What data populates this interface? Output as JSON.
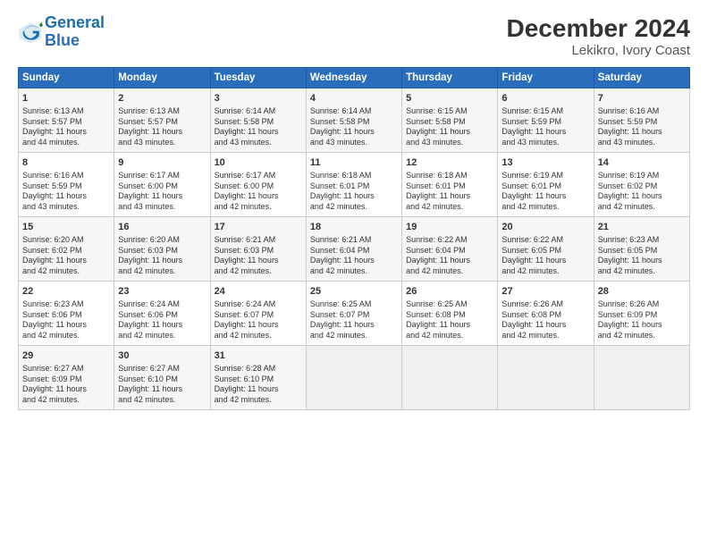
{
  "logo": {
    "line1": "General",
    "line2": "Blue"
  },
  "title": "December 2024",
  "subtitle": "Lekikro, Ivory Coast",
  "days_of_week": [
    "Sunday",
    "Monday",
    "Tuesday",
    "Wednesday",
    "Thursday",
    "Friday",
    "Saturday"
  ],
  "weeks": [
    [
      {
        "day": "1",
        "info": "Sunrise: 6:13 AM\nSunset: 5:57 PM\nDaylight: 11 hours\nand 44 minutes."
      },
      {
        "day": "2",
        "info": "Sunrise: 6:13 AM\nSunset: 5:57 PM\nDaylight: 11 hours\nand 43 minutes."
      },
      {
        "day": "3",
        "info": "Sunrise: 6:14 AM\nSunset: 5:58 PM\nDaylight: 11 hours\nand 43 minutes."
      },
      {
        "day": "4",
        "info": "Sunrise: 6:14 AM\nSunset: 5:58 PM\nDaylight: 11 hours\nand 43 minutes."
      },
      {
        "day": "5",
        "info": "Sunrise: 6:15 AM\nSunset: 5:58 PM\nDaylight: 11 hours\nand 43 minutes."
      },
      {
        "day": "6",
        "info": "Sunrise: 6:15 AM\nSunset: 5:59 PM\nDaylight: 11 hours\nand 43 minutes."
      },
      {
        "day": "7",
        "info": "Sunrise: 6:16 AM\nSunset: 5:59 PM\nDaylight: 11 hours\nand 43 minutes."
      }
    ],
    [
      {
        "day": "8",
        "info": "Sunrise: 6:16 AM\nSunset: 5:59 PM\nDaylight: 11 hours\nand 43 minutes."
      },
      {
        "day": "9",
        "info": "Sunrise: 6:17 AM\nSunset: 6:00 PM\nDaylight: 11 hours\nand 43 minutes."
      },
      {
        "day": "10",
        "info": "Sunrise: 6:17 AM\nSunset: 6:00 PM\nDaylight: 11 hours\nand 42 minutes."
      },
      {
        "day": "11",
        "info": "Sunrise: 6:18 AM\nSunset: 6:01 PM\nDaylight: 11 hours\nand 42 minutes."
      },
      {
        "day": "12",
        "info": "Sunrise: 6:18 AM\nSunset: 6:01 PM\nDaylight: 11 hours\nand 42 minutes."
      },
      {
        "day": "13",
        "info": "Sunrise: 6:19 AM\nSunset: 6:01 PM\nDaylight: 11 hours\nand 42 minutes."
      },
      {
        "day": "14",
        "info": "Sunrise: 6:19 AM\nSunset: 6:02 PM\nDaylight: 11 hours\nand 42 minutes."
      }
    ],
    [
      {
        "day": "15",
        "info": "Sunrise: 6:20 AM\nSunset: 6:02 PM\nDaylight: 11 hours\nand 42 minutes."
      },
      {
        "day": "16",
        "info": "Sunrise: 6:20 AM\nSunset: 6:03 PM\nDaylight: 11 hours\nand 42 minutes."
      },
      {
        "day": "17",
        "info": "Sunrise: 6:21 AM\nSunset: 6:03 PM\nDaylight: 11 hours\nand 42 minutes."
      },
      {
        "day": "18",
        "info": "Sunrise: 6:21 AM\nSunset: 6:04 PM\nDaylight: 11 hours\nand 42 minutes."
      },
      {
        "day": "19",
        "info": "Sunrise: 6:22 AM\nSunset: 6:04 PM\nDaylight: 11 hours\nand 42 minutes."
      },
      {
        "day": "20",
        "info": "Sunrise: 6:22 AM\nSunset: 6:05 PM\nDaylight: 11 hours\nand 42 minutes."
      },
      {
        "day": "21",
        "info": "Sunrise: 6:23 AM\nSunset: 6:05 PM\nDaylight: 11 hours\nand 42 minutes."
      }
    ],
    [
      {
        "day": "22",
        "info": "Sunrise: 6:23 AM\nSunset: 6:06 PM\nDaylight: 11 hours\nand 42 minutes."
      },
      {
        "day": "23",
        "info": "Sunrise: 6:24 AM\nSunset: 6:06 PM\nDaylight: 11 hours\nand 42 minutes."
      },
      {
        "day": "24",
        "info": "Sunrise: 6:24 AM\nSunset: 6:07 PM\nDaylight: 11 hours\nand 42 minutes."
      },
      {
        "day": "25",
        "info": "Sunrise: 6:25 AM\nSunset: 6:07 PM\nDaylight: 11 hours\nand 42 minutes."
      },
      {
        "day": "26",
        "info": "Sunrise: 6:25 AM\nSunset: 6:08 PM\nDaylight: 11 hours\nand 42 minutes."
      },
      {
        "day": "27",
        "info": "Sunrise: 6:26 AM\nSunset: 6:08 PM\nDaylight: 11 hours\nand 42 minutes."
      },
      {
        "day": "28",
        "info": "Sunrise: 6:26 AM\nSunset: 6:09 PM\nDaylight: 11 hours\nand 42 minutes."
      }
    ],
    [
      {
        "day": "29",
        "info": "Sunrise: 6:27 AM\nSunset: 6:09 PM\nDaylight: 11 hours\nand 42 minutes."
      },
      {
        "day": "30",
        "info": "Sunrise: 6:27 AM\nSunset: 6:10 PM\nDaylight: 11 hours\nand 42 minutes."
      },
      {
        "day": "31",
        "info": "Sunrise: 6:28 AM\nSunset: 6:10 PM\nDaylight: 11 hours\nand 42 minutes."
      },
      {
        "day": "",
        "info": ""
      },
      {
        "day": "",
        "info": ""
      },
      {
        "day": "",
        "info": ""
      },
      {
        "day": "",
        "info": ""
      }
    ]
  ]
}
